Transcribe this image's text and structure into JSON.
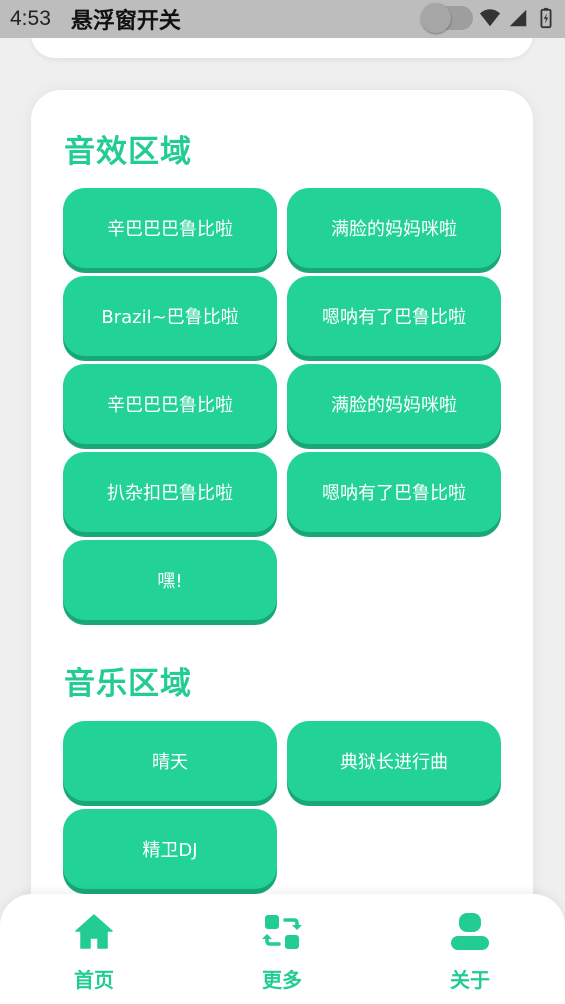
{
  "status": {
    "time": "4:53",
    "title": "悬浮窗开关"
  },
  "sections": {
    "sfx": {
      "title": "音效区域",
      "buttons": [
        "辛巴巴巴鲁比啦",
        "满脸的妈妈咪啦",
        "Brazil~巴鲁比啦",
        "嗯呐有了巴鲁比啦",
        "辛巴巴巴鲁比啦",
        "满脸的妈妈咪啦",
        "扒杂扣巴鲁比啦",
        "嗯呐有了巴鲁比啦",
        "嘿!"
      ]
    },
    "music": {
      "title": "音乐区域",
      "buttons": [
        "晴天",
        "典狱长进行曲",
        "精卫DJ"
      ]
    }
  },
  "nav": {
    "items": [
      {
        "label": "首页",
        "icon": "home-icon"
      },
      {
        "label": "更多",
        "icon": "refresh-grid-icon"
      },
      {
        "label": "关于",
        "icon": "user-icon"
      }
    ]
  },
  "colors": {
    "accent": "#23d296",
    "accent_shadow": "#17a876",
    "title": "#22cc92"
  }
}
